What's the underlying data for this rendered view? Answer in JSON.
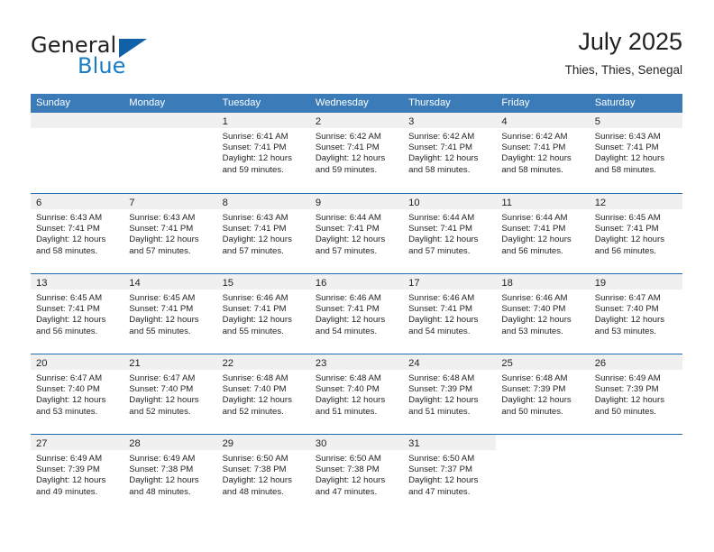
{
  "brand": {
    "name_part1": "General",
    "name_part2": "Blue",
    "logo_icon": "triangle-logo-icon"
  },
  "header": {
    "month_title": "July 2025",
    "location": "Thies, Thies, Senegal"
  },
  "calendar": {
    "weekdays": [
      "Sunday",
      "Monday",
      "Tuesday",
      "Wednesday",
      "Thursday",
      "Friday",
      "Saturday"
    ],
    "accent_color": "#3b7cb8",
    "row_border_color": "#1f6cb0",
    "day_strip_color": "#f0f0f0",
    "weeks": [
      [
        {
          "day": "",
          "sunrise": "",
          "sunset": "",
          "daylight_line1": "",
          "daylight_line2": "",
          "empty": true
        },
        {
          "day": "",
          "sunrise": "",
          "sunset": "",
          "daylight_line1": "",
          "daylight_line2": "",
          "empty": true
        },
        {
          "day": "1",
          "sunrise": "Sunrise: 6:41 AM",
          "sunset": "Sunset: 7:41 PM",
          "daylight_line1": "Daylight: 12 hours",
          "daylight_line2": "and 59 minutes."
        },
        {
          "day": "2",
          "sunrise": "Sunrise: 6:42 AM",
          "sunset": "Sunset: 7:41 PM",
          "daylight_line1": "Daylight: 12 hours",
          "daylight_line2": "and 59 minutes."
        },
        {
          "day": "3",
          "sunrise": "Sunrise: 6:42 AM",
          "sunset": "Sunset: 7:41 PM",
          "daylight_line1": "Daylight: 12 hours",
          "daylight_line2": "and 58 minutes."
        },
        {
          "day": "4",
          "sunrise": "Sunrise: 6:42 AM",
          "sunset": "Sunset: 7:41 PM",
          "daylight_line1": "Daylight: 12 hours",
          "daylight_line2": "and 58 minutes."
        },
        {
          "day": "5",
          "sunrise": "Sunrise: 6:43 AM",
          "sunset": "Sunset: 7:41 PM",
          "daylight_line1": "Daylight: 12 hours",
          "daylight_line2": "and 58 minutes."
        }
      ],
      [
        {
          "day": "6",
          "sunrise": "Sunrise: 6:43 AM",
          "sunset": "Sunset: 7:41 PM",
          "daylight_line1": "Daylight: 12 hours",
          "daylight_line2": "and 58 minutes."
        },
        {
          "day": "7",
          "sunrise": "Sunrise: 6:43 AM",
          "sunset": "Sunset: 7:41 PM",
          "daylight_line1": "Daylight: 12 hours",
          "daylight_line2": "and 57 minutes."
        },
        {
          "day": "8",
          "sunrise": "Sunrise: 6:43 AM",
          "sunset": "Sunset: 7:41 PM",
          "daylight_line1": "Daylight: 12 hours",
          "daylight_line2": "and 57 minutes."
        },
        {
          "day": "9",
          "sunrise": "Sunrise: 6:44 AM",
          "sunset": "Sunset: 7:41 PM",
          "daylight_line1": "Daylight: 12 hours",
          "daylight_line2": "and 57 minutes."
        },
        {
          "day": "10",
          "sunrise": "Sunrise: 6:44 AM",
          "sunset": "Sunset: 7:41 PM",
          "daylight_line1": "Daylight: 12 hours",
          "daylight_line2": "and 57 minutes."
        },
        {
          "day": "11",
          "sunrise": "Sunrise: 6:44 AM",
          "sunset": "Sunset: 7:41 PM",
          "daylight_line1": "Daylight: 12 hours",
          "daylight_line2": "and 56 minutes."
        },
        {
          "day": "12",
          "sunrise": "Sunrise: 6:45 AM",
          "sunset": "Sunset: 7:41 PM",
          "daylight_line1": "Daylight: 12 hours",
          "daylight_line2": "and 56 minutes."
        }
      ],
      [
        {
          "day": "13",
          "sunrise": "Sunrise: 6:45 AM",
          "sunset": "Sunset: 7:41 PM",
          "daylight_line1": "Daylight: 12 hours",
          "daylight_line2": "and 56 minutes."
        },
        {
          "day": "14",
          "sunrise": "Sunrise: 6:45 AM",
          "sunset": "Sunset: 7:41 PM",
          "daylight_line1": "Daylight: 12 hours",
          "daylight_line2": "and 55 minutes."
        },
        {
          "day": "15",
          "sunrise": "Sunrise: 6:46 AM",
          "sunset": "Sunset: 7:41 PM",
          "daylight_line1": "Daylight: 12 hours",
          "daylight_line2": "and 55 minutes."
        },
        {
          "day": "16",
          "sunrise": "Sunrise: 6:46 AM",
          "sunset": "Sunset: 7:41 PM",
          "daylight_line1": "Daylight: 12 hours",
          "daylight_line2": "and 54 minutes."
        },
        {
          "day": "17",
          "sunrise": "Sunrise: 6:46 AM",
          "sunset": "Sunset: 7:41 PM",
          "daylight_line1": "Daylight: 12 hours",
          "daylight_line2": "and 54 minutes."
        },
        {
          "day": "18",
          "sunrise": "Sunrise: 6:46 AM",
          "sunset": "Sunset: 7:40 PM",
          "daylight_line1": "Daylight: 12 hours",
          "daylight_line2": "and 53 minutes."
        },
        {
          "day": "19",
          "sunrise": "Sunrise: 6:47 AM",
          "sunset": "Sunset: 7:40 PM",
          "daylight_line1": "Daylight: 12 hours",
          "daylight_line2": "and 53 minutes."
        }
      ],
      [
        {
          "day": "20",
          "sunrise": "Sunrise: 6:47 AM",
          "sunset": "Sunset: 7:40 PM",
          "daylight_line1": "Daylight: 12 hours",
          "daylight_line2": "and 53 minutes."
        },
        {
          "day": "21",
          "sunrise": "Sunrise: 6:47 AM",
          "sunset": "Sunset: 7:40 PM",
          "daylight_line1": "Daylight: 12 hours",
          "daylight_line2": "and 52 minutes."
        },
        {
          "day": "22",
          "sunrise": "Sunrise: 6:48 AM",
          "sunset": "Sunset: 7:40 PM",
          "daylight_line1": "Daylight: 12 hours",
          "daylight_line2": "and 52 minutes."
        },
        {
          "day": "23",
          "sunrise": "Sunrise: 6:48 AM",
          "sunset": "Sunset: 7:40 PM",
          "daylight_line1": "Daylight: 12 hours",
          "daylight_line2": "and 51 minutes."
        },
        {
          "day": "24",
          "sunrise": "Sunrise: 6:48 AM",
          "sunset": "Sunset: 7:39 PM",
          "daylight_line1": "Daylight: 12 hours",
          "daylight_line2": "and 51 minutes."
        },
        {
          "day": "25",
          "sunrise": "Sunrise: 6:48 AM",
          "sunset": "Sunset: 7:39 PM",
          "daylight_line1": "Daylight: 12 hours",
          "daylight_line2": "and 50 minutes."
        },
        {
          "day": "26",
          "sunrise": "Sunrise: 6:49 AM",
          "sunset": "Sunset: 7:39 PM",
          "daylight_line1": "Daylight: 12 hours",
          "daylight_line2": "and 50 minutes."
        }
      ],
      [
        {
          "day": "27",
          "sunrise": "Sunrise: 6:49 AM",
          "sunset": "Sunset: 7:39 PM",
          "daylight_line1": "Daylight: 12 hours",
          "daylight_line2": "and 49 minutes."
        },
        {
          "day": "28",
          "sunrise": "Sunrise: 6:49 AM",
          "sunset": "Sunset: 7:38 PM",
          "daylight_line1": "Daylight: 12 hours",
          "daylight_line2": "and 48 minutes."
        },
        {
          "day": "29",
          "sunrise": "Sunrise: 6:50 AM",
          "sunset": "Sunset: 7:38 PM",
          "daylight_line1": "Daylight: 12 hours",
          "daylight_line2": "and 48 minutes."
        },
        {
          "day": "30",
          "sunrise": "Sunrise: 6:50 AM",
          "sunset": "Sunset: 7:38 PM",
          "daylight_line1": "Daylight: 12 hours",
          "daylight_line2": "and 47 minutes."
        },
        {
          "day": "31",
          "sunrise": "Sunrise: 6:50 AM",
          "sunset": "Sunset: 7:37 PM",
          "daylight_line1": "Daylight: 12 hours",
          "daylight_line2": "and 47 minutes."
        },
        {
          "day": "",
          "sunrise": "",
          "sunset": "",
          "daylight_line1": "",
          "daylight_line2": "",
          "blank": true
        },
        {
          "day": "",
          "sunrise": "",
          "sunset": "",
          "daylight_line1": "",
          "daylight_line2": "",
          "blank": true
        }
      ]
    ]
  }
}
